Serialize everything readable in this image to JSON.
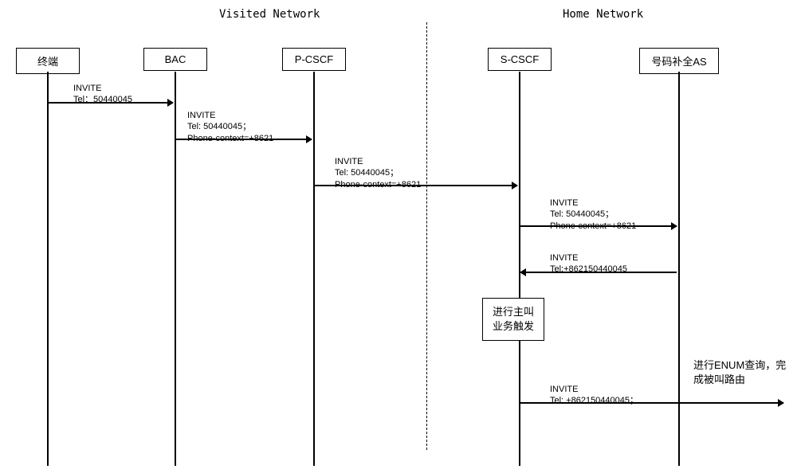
{
  "networks": {
    "visited": "Visited Network",
    "home": "Home Network"
  },
  "lifelines": {
    "terminal": "终端",
    "bac": "BAC",
    "pcscf": "P-CSCF",
    "scscf": "S-CSCF",
    "as": "号码补全AS"
  },
  "messages": {
    "m1": {
      "title": "INVITE",
      "line1": "Tel：50440045"
    },
    "m2": {
      "title": "INVITE",
      "line1": "Tel: 50440045；",
      "line2": "Phone-context=+8621"
    },
    "m3": {
      "title": "INVITE",
      "line1": "Tel: 50440045；",
      "line2": "Phone-context=+8621"
    },
    "m4": {
      "title": "INVITE",
      "line1": "Tel: 50440045；",
      "line2": "Phone-context=+8621"
    },
    "m5": {
      "title": "INVITE",
      "line1": "Tel:+862150440045"
    },
    "m6": {
      "title": "INVITE",
      "line1": "Tel: +862150440045；"
    }
  },
  "actionBox": {
    "line1": "进行主叫",
    "line2": "业务触发"
  },
  "sideLabel": {
    "line1": "进行ENUM查询，完",
    "line2": "成被叫路由"
  }
}
